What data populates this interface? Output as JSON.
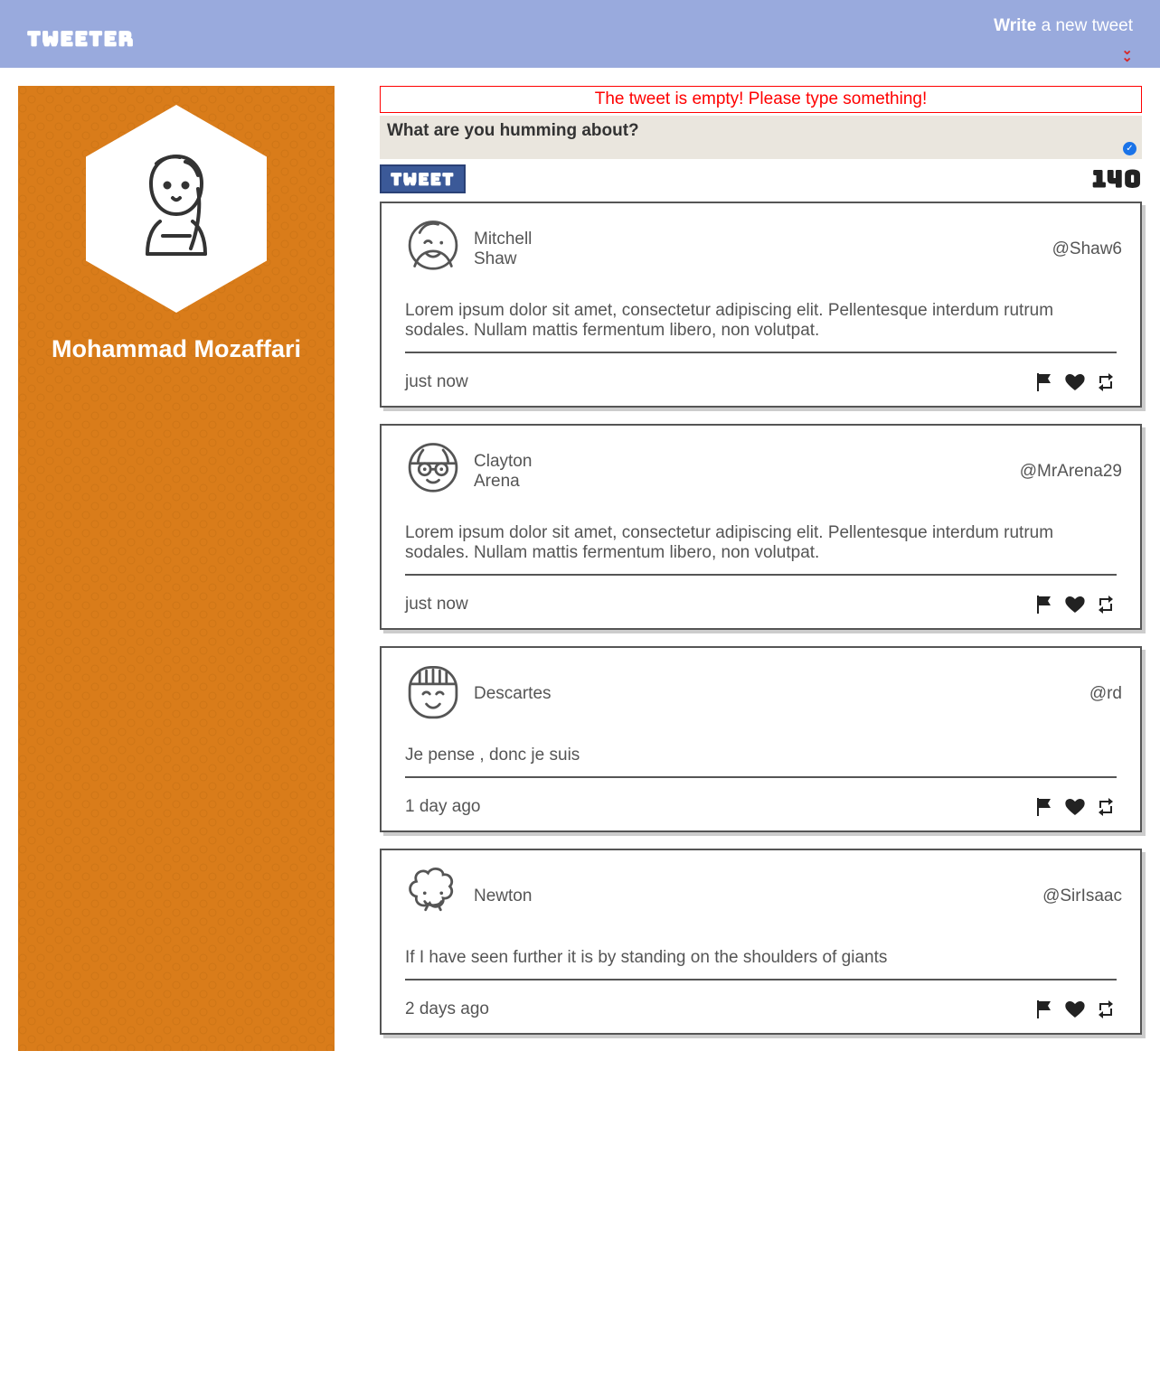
{
  "header": {
    "logo": "tweeter",
    "write_bold": "Write",
    "write_rest": " a new tweet"
  },
  "profile": {
    "name": "Mohammad Mozaffari"
  },
  "compose": {
    "error": "The tweet is empty! Please type something!",
    "placeholder": "What are you humming about?",
    "button": "TWEET",
    "counter": "140"
  },
  "tweets": [
    {
      "first": "Mitchell",
      "last": "Shaw",
      "handle": "@Shaw6",
      "body": "Lorem ipsum dolor sit amet, consectetur adipiscing elit. Pellentesque interdum rutrum sodales. Nullam mattis fermentum libero, non volutpat.",
      "time": "just now",
      "avatar": "face-male-wink"
    },
    {
      "first": "Clayton",
      "last": "Arena",
      "handle": "@MrArena29",
      "body": "Lorem ipsum dolor sit amet, consectetur adipiscing elit. Pellentesque interdum rutrum sodales. Nullam mattis fermentum libero, non volutpat.",
      "time": "just now",
      "avatar": "face-glasses"
    },
    {
      "first": "Descartes",
      "last": "",
      "handle": "@rd",
      "body": "Je pense , donc je suis",
      "time": "1 day ago",
      "avatar": "face-round-bangs"
    },
    {
      "first": "Newton",
      "last": "",
      "handle": "@SirIsaac",
      "body": "If I have seen further it is by standing on the shoulders of giants",
      "time": "2 days ago",
      "avatar": "face-cloud"
    }
  ]
}
